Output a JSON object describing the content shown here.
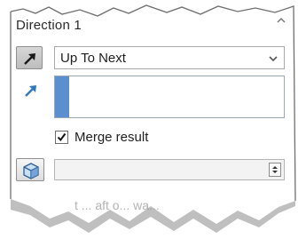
{
  "panel": {
    "title": "Direction 1",
    "collapse_icon": "chevron-up-icon"
  },
  "direction": {
    "reverse_icon": "reverse-direction-icon",
    "end_condition": "Up To Next",
    "dropdown_icon": "chevron-down-icon",
    "direction_ref_icon": "direction-arrow-icon",
    "accent_color": "#5b8fd0"
  },
  "options": {
    "merge_result_label": "Merge result",
    "merge_result_checked": true
  },
  "bodies": {
    "body_icon": "solid-body-icon",
    "value": "",
    "spinner_icon": "spinner-icon"
  },
  "footer": {
    "faded_text": "t ... aft o... wa..."
  }
}
